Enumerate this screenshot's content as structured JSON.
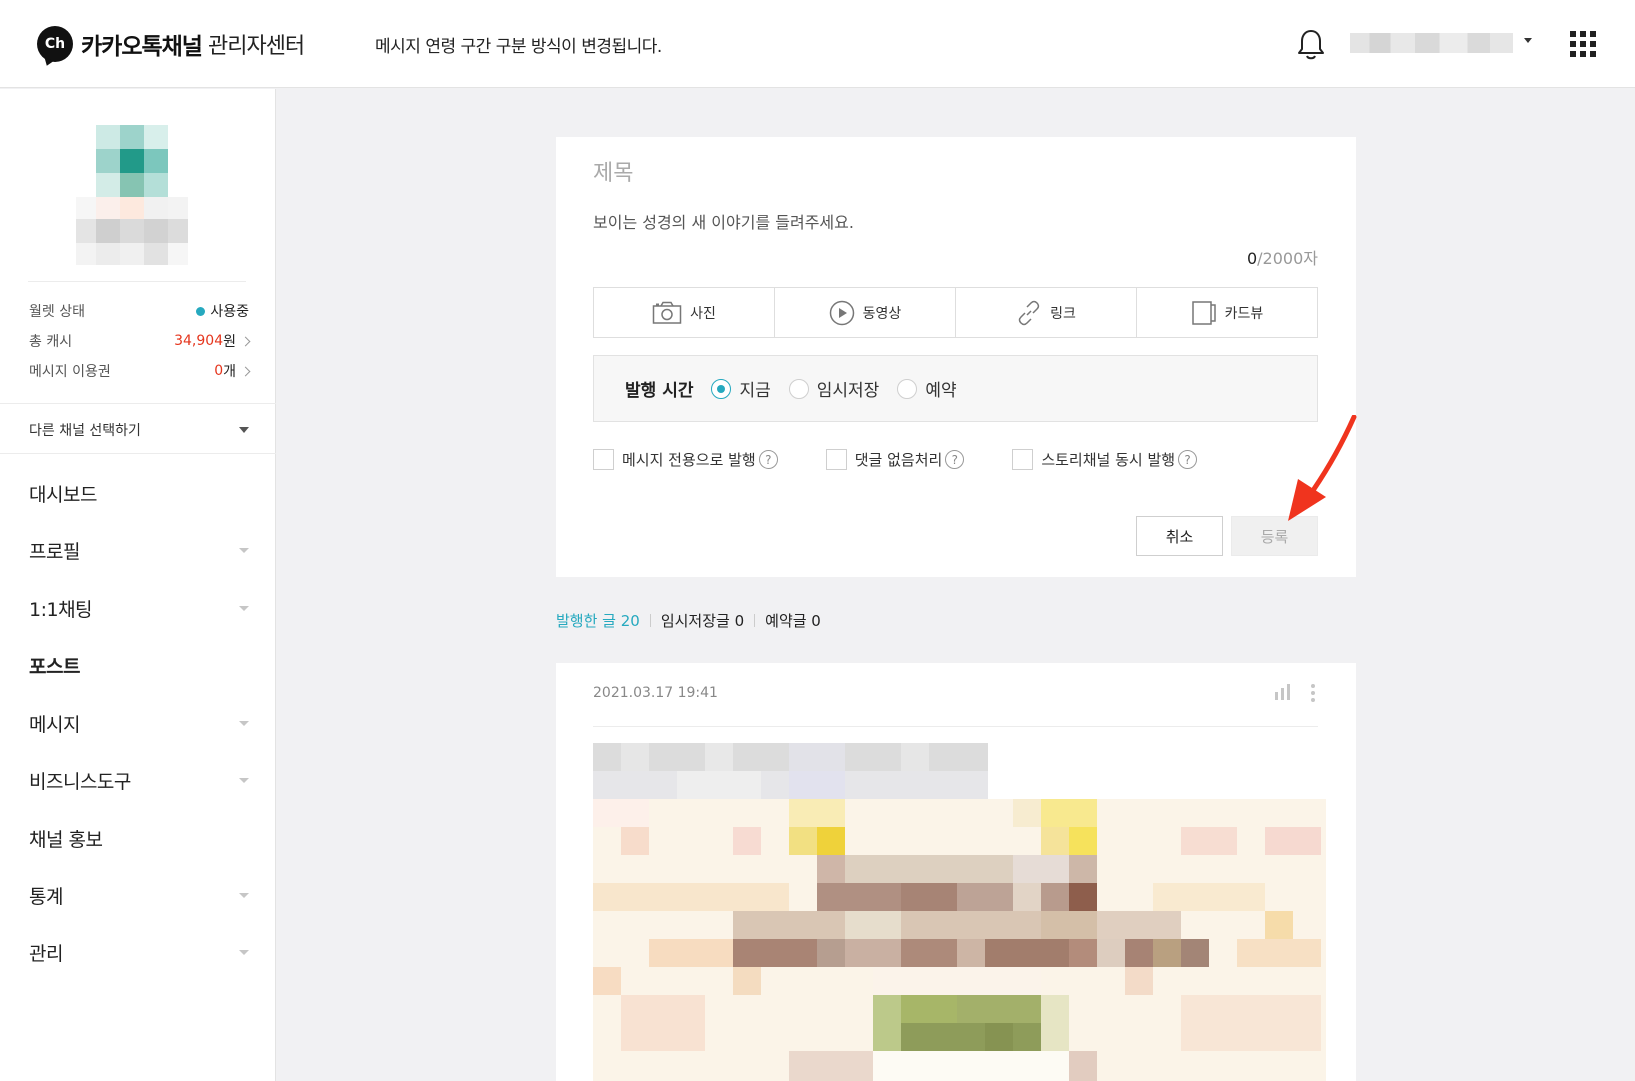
{
  "header": {
    "logo_badge": "Ch",
    "brand": "카카오톡채널",
    "brand_sub": "관리자센터",
    "notice": "메시지 연령 구간 구분 방식이 변경됩니다."
  },
  "sidebar": {
    "wallet": [
      {
        "label": "월렛 상태",
        "value": "사용중",
        "unit": ""
      },
      {
        "label": "총 캐시",
        "value": "34,904",
        "unit": "원"
      },
      {
        "label": "메시지 이용권",
        "value": "0",
        "unit": "개"
      }
    ],
    "channel_select": "다른 채널 선택하기",
    "nav": [
      {
        "label": "대시보드"
      },
      {
        "label": "프로필"
      },
      {
        "label": "1:1채팅"
      },
      {
        "label": "포스트"
      },
      {
        "label": "메시지"
      },
      {
        "label": "비즈니스도구"
      },
      {
        "label": "채널 홍보"
      },
      {
        "label": "통계"
      },
      {
        "label": "관리"
      }
    ]
  },
  "editor": {
    "title_placeholder": "제목",
    "body_placeholder": "보이는 성경의 새 이야기를 들려주세요.",
    "char_count_current": "0",
    "char_count_max": "/2000자",
    "attachments": [
      "사진",
      "동영상",
      "링크",
      "카드뷰"
    ],
    "publish_label": "발행 시간",
    "publish_options": [
      "지금",
      "임시저장",
      "예약"
    ],
    "options": [
      "메시지 전용으로 발행",
      "댓글 없음처리",
      "스토리채널 동시 발행"
    ],
    "help_glyph": "?",
    "cancel_label": "취소",
    "submit_label": "등록"
  },
  "post_tabs": [
    "발행한 글 20",
    "임시저장글 0",
    "예약글 0"
  ],
  "post": {
    "date": "2021.03.17 19:41"
  },
  "colors": {
    "accent": "#26a9bf",
    "cash": "#e5361e",
    "annotation_arrow": "#f0341e"
  }
}
